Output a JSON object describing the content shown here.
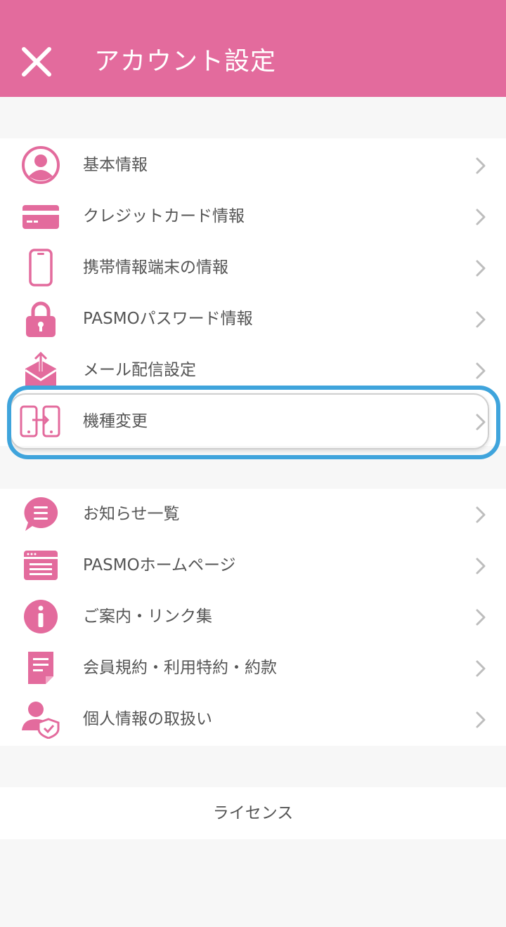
{
  "header": {
    "title": "アカウント設定",
    "close_icon": "close-icon",
    "background": "#e36b9d"
  },
  "group1": {
    "items": [
      {
        "label": "基本情報",
        "icon": "user-icon"
      },
      {
        "label": "クレジットカード情報",
        "icon": "credit-card-icon"
      },
      {
        "label": "携帯情報端末の情報",
        "icon": "smartphone-icon"
      },
      {
        "label": "PASMOパスワード情報",
        "icon": "lock-icon"
      },
      {
        "label": "メール配信設定",
        "icon": "mail-send-icon"
      },
      {
        "label": "機種変更",
        "icon": "device-transfer-icon"
      }
    ]
  },
  "group2": {
    "items": [
      {
        "label": "お知らせ一覧",
        "icon": "notice-bubble-icon"
      },
      {
        "label": "PASMOホームページ",
        "icon": "browser-icon"
      },
      {
        "label": "ご案内・リンク集",
        "icon": "info-icon"
      },
      {
        "label": "会員規約・利用特約・約款",
        "icon": "document-icon"
      },
      {
        "label": "個人情報の取扱い",
        "icon": "privacy-user-icon"
      }
    ]
  },
  "license": {
    "label": "ライセンス"
  },
  "colors": {
    "accent": "#e36b9d",
    "highlight": "#3fa4dc",
    "chevron": "#bdbdbd"
  }
}
